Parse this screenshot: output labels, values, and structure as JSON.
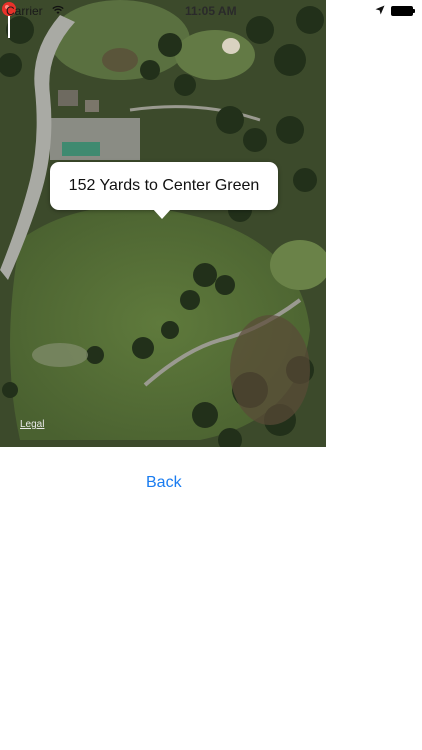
{
  "status_bar": {
    "carrier": "Carrier",
    "time": "11:05 AM"
  },
  "map": {
    "callout_text": "152 Yards to Center Green",
    "legal_link": "Legal",
    "pin_color": "#e8322a"
  },
  "actions": {
    "back_label": "Back"
  },
  "colors": {
    "accent": "#1a7cf0"
  }
}
